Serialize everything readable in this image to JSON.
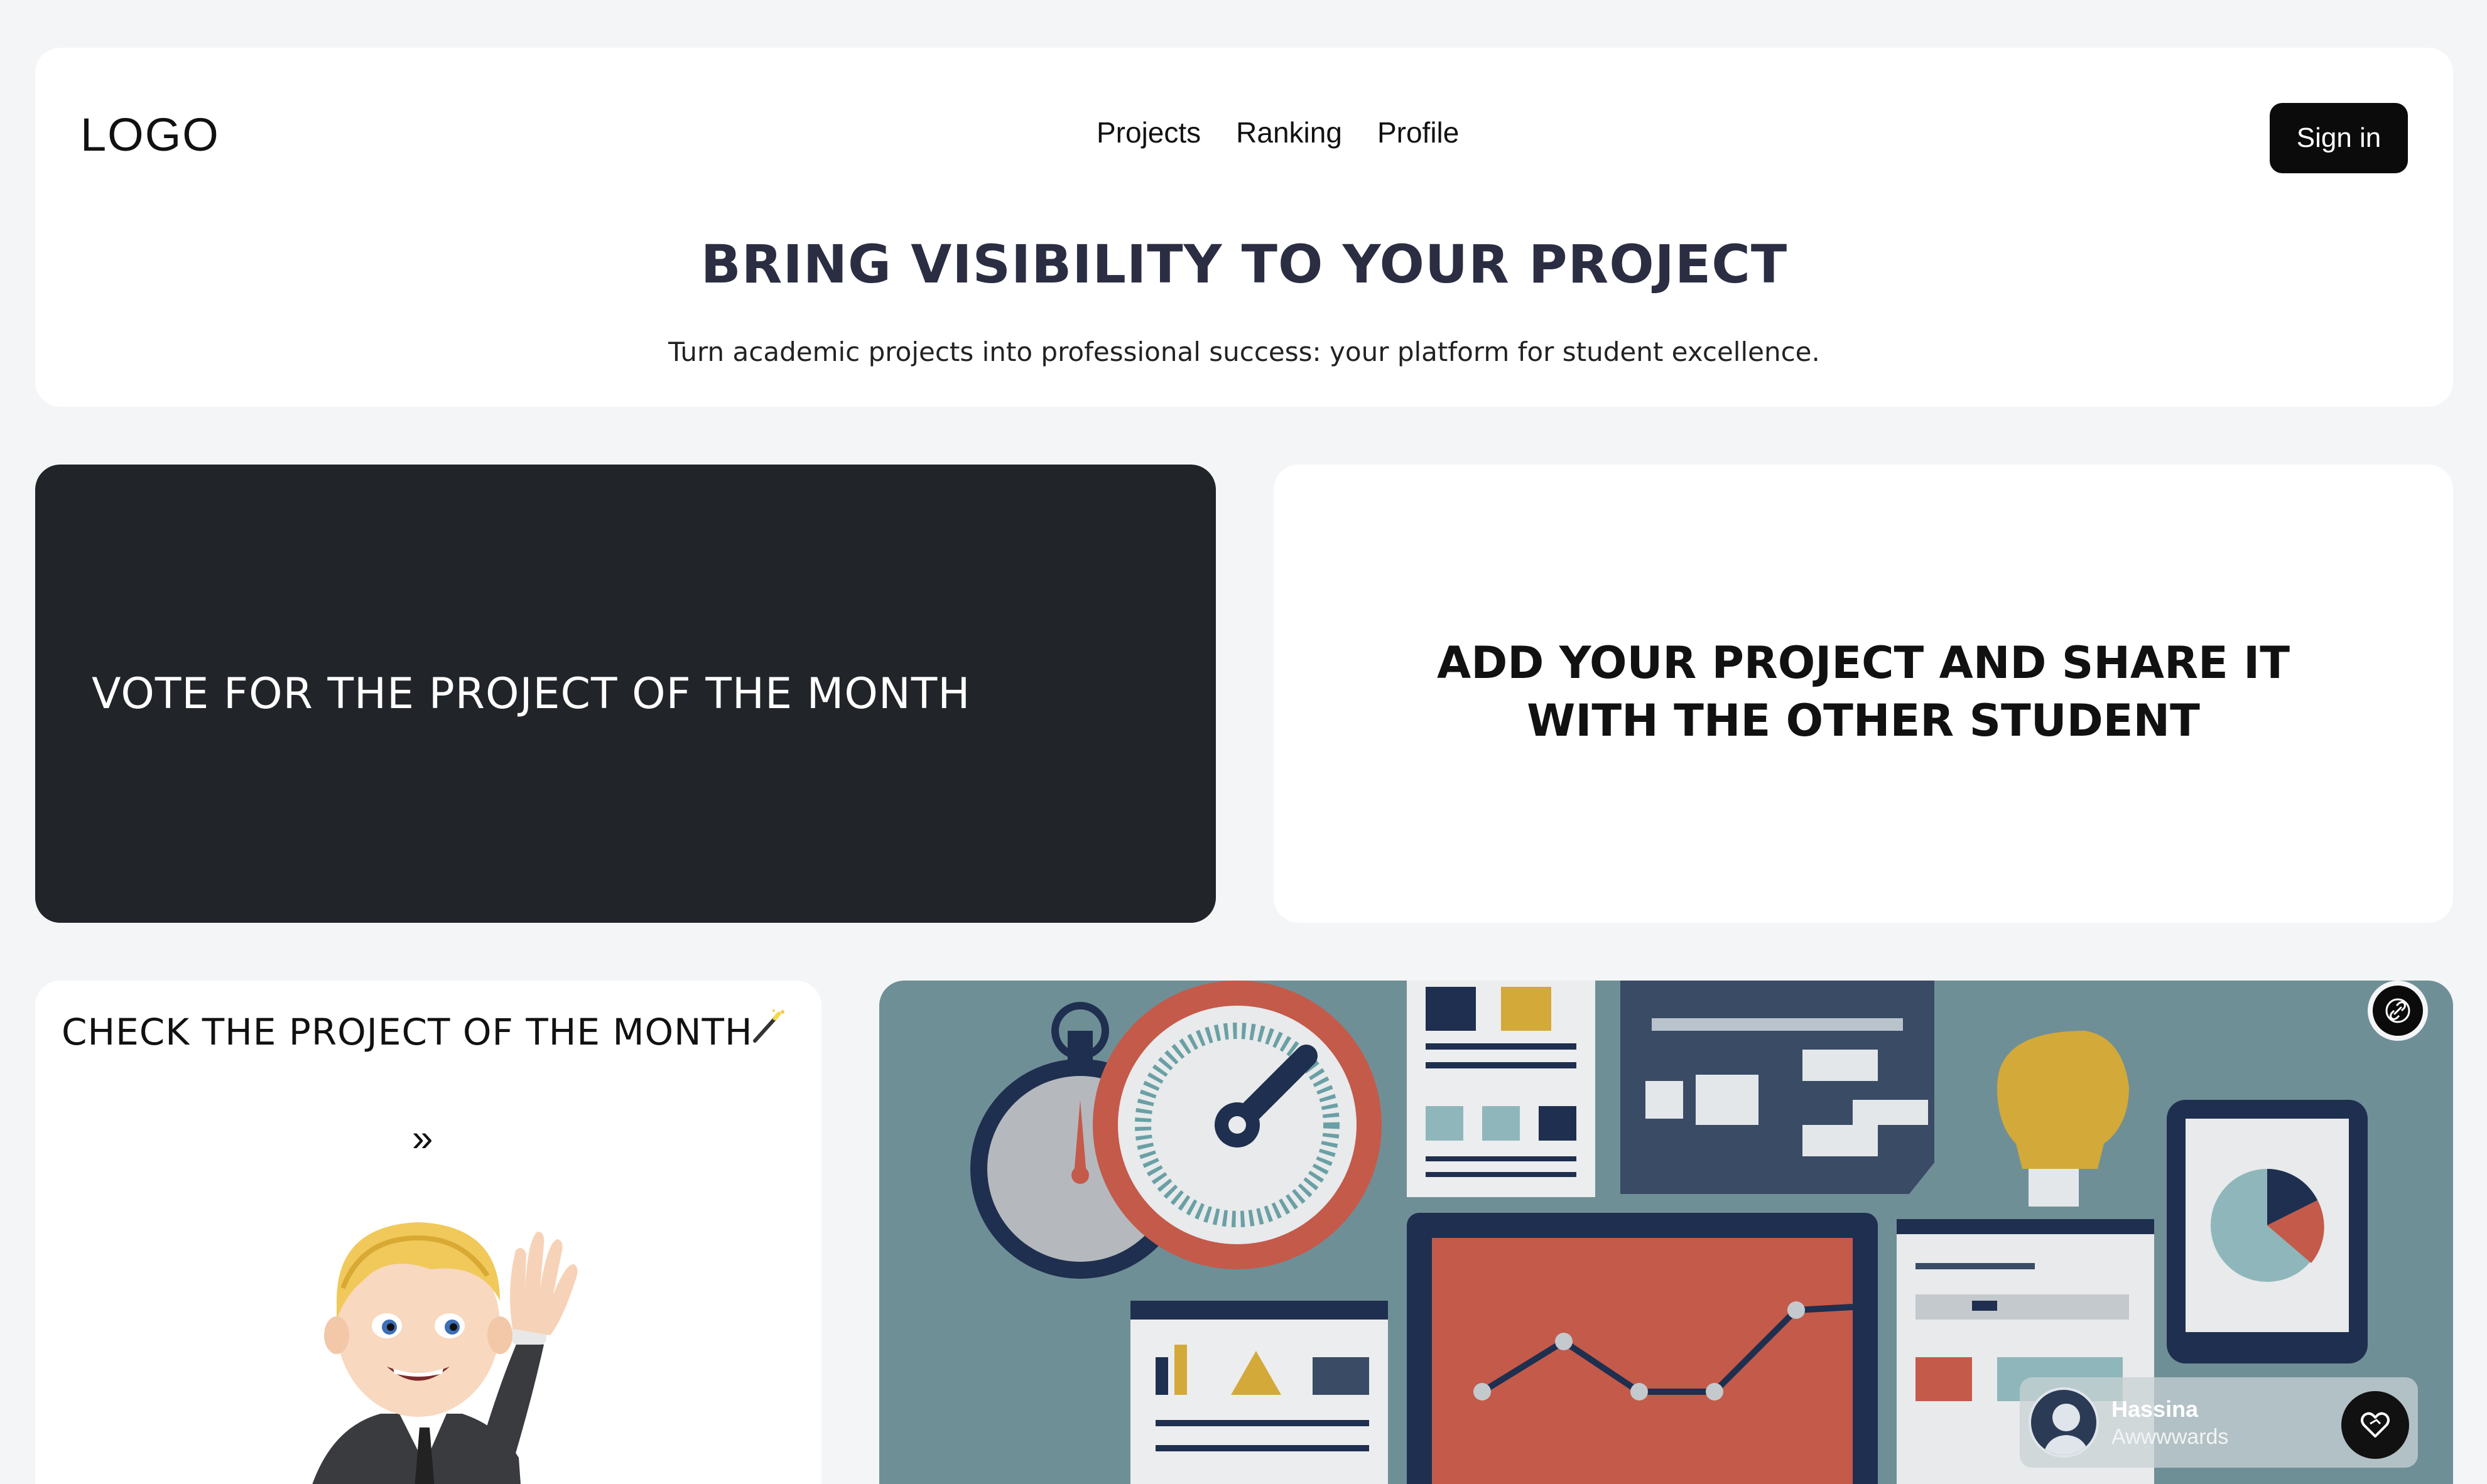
{
  "header": {
    "logo": "LOGO",
    "nav": [
      "Projects",
      "Ranking",
      "Profile"
    ],
    "signin_label": "Sign in",
    "hero_title": "BRING VISIBILITY TO YOUR PROJECT",
    "hero_subtitle": "Turn academic projects into professional success: your platform for student excellence."
  },
  "vote_card": {
    "title": "VOTE FOR THE PROJECT OF THE MONTH"
  },
  "add_card": {
    "title": "ADD YOUR PROJECT AND SHARE IT WITH THE OTHER STUDENT"
  },
  "check_card": {
    "title": "CHECK THE PROJECT OF THE MONTH",
    "chevron": "»"
  },
  "showcase": {
    "author_name": "Hassina",
    "author_site": "Awwwwards",
    "link_icon": "link-icon",
    "like_icon": "heart-icon"
  },
  "colors": {
    "background": "#f4f5f7",
    "dark_card": "#212428",
    "accent_button": "#0b0b0c",
    "illustration_bg": "#6f8f96"
  }
}
